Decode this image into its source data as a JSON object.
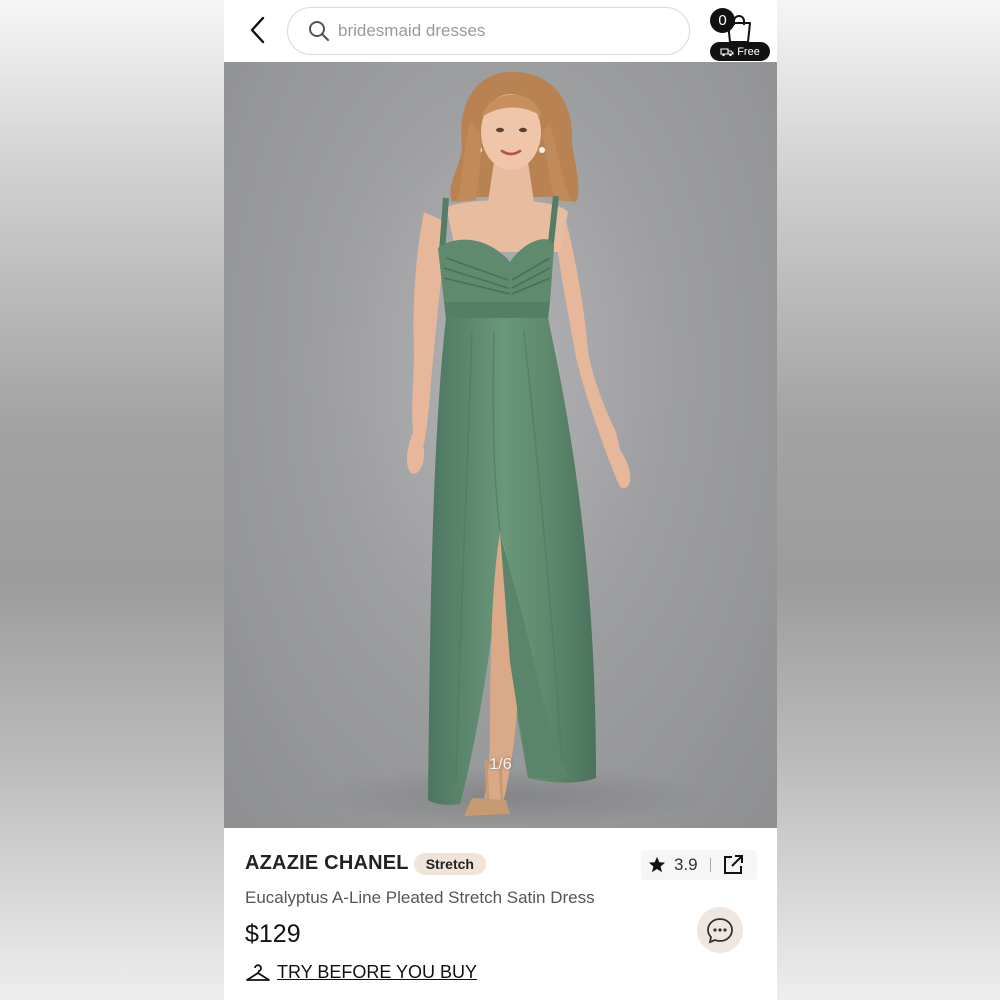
{
  "header": {
    "search_placeholder": "bridesmaid dresses",
    "cart_count": "0",
    "shipping_badge": "Free"
  },
  "gallery": {
    "counter": "1/6",
    "current": 1,
    "total": 6
  },
  "product": {
    "brand": "AZAZIE CHANEL",
    "tag": "Stretch",
    "rating": "3.9",
    "title": "Eucalyptus A-Line Pleated Stretch Satin Dress",
    "price": "$129",
    "try_before_label": "TRY BEFORE YOU BUY"
  },
  "colors": {
    "dress": "#5f8a6e",
    "badge_bg": "#f0e3d8",
    "chat_bg": "#efe6df",
    "photo_bg": "#9d9ea0"
  },
  "icons": [
    "back-arrow-icon",
    "search-icon",
    "shopping-bag-icon",
    "delivery-truck-icon",
    "star-icon",
    "share-icon",
    "chat-icon",
    "hanger-icon"
  ]
}
